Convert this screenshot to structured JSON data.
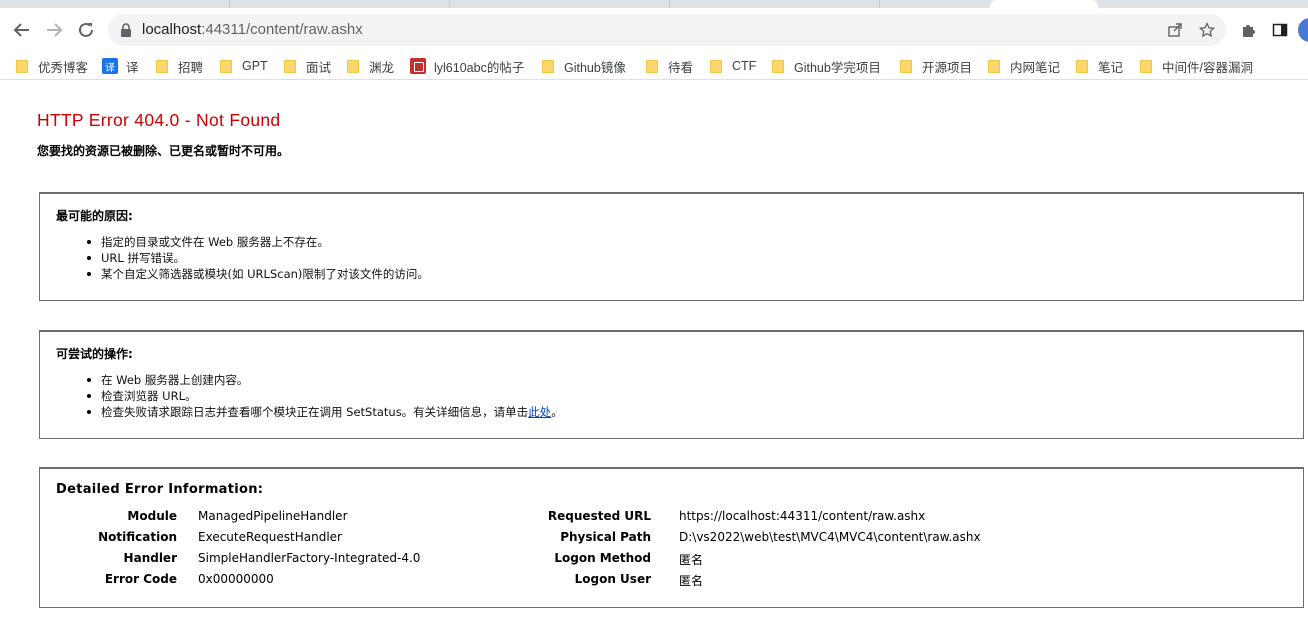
{
  "browser": {
    "url_host": "localhost",
    "url_path": ":44311/content/raw.ashx"
  },
  "bookmarks": [
    {
      "label": "优秀博客",
      "icon": "folder-icon"
    },
    {
      "label": "译",
      "icon": "translate-icon"
    },
    {
      "label": "招聘",
      "icon": "folder-icon"
    },
    {
      "label": "GPT",
      "icon": "folder-icon"
    },
    {
      "label": "面试",
      "icon": "folder-icon"
    },
    {
      "label": "渊龙",
      "icon": "folder-icon"
    },
    {
      "label": "lyl610abc的帖子",
      "icon": "site-favicon-icon"
    },
    {
      "label": "Github镜像",
      "icon": "folder-icon"
    },
    {
      "label": "待看",
      "icon": "folder-icon"
    },
    {
      "label": "CTF",
      "icon": "folder-icon"
    },
    {
      "label": "Github学完项目",
      "icon": "folder-icon"
    },
    {
      "label": "开源项目",
      "icon": "folder-icon"
    },
    {
      "label": "内网笔记",
      "icon": "folder-icon"
    },
    {
      "label": "笔记",
      "icon": "folder-icon"
    },
    {
      "label": "中间件/容器漏洞",
      "icon": "folder-icon"
    }
  ],
  "error": {
    "title": "HTTP Error 404.0 - Not Found",
    "subtitle": "您要找的资源已被删除、已更名或暂时不可用。",
    "causes_heading": "最可能的原因:",
    "causes": [
      "指定的目录或文件在 Web 服务器上不存在。",
      "URL 拼写错误。",
      "某个自定义筛选器或模块(如 URLScan)限制了对该文件的访问。"
    ],
    "actions_heading": "可尝试的操作:",
    "actions": [
      "在 Web 服务器上创建内容。",
      "检查浏览器 URL。"
    ],
    "action3_prefix": "检查失败请求跟踪日志并查看哪个模块正在调用 SetStatus。有关详细信息，请单击",
    "action3_link": "此处",
    "action3_suffix": "。",
    "detail_heading": "Detailed Error Information:",
    "details_left": [
      {
        "label": "Module",
        "value": "ManagedPipelineHandler"
      },
      {
        "label": "Notification",
        "value": "ExecuteRequestHandler"
      },
      {
        "label": "Handler",
        "value": "SimpleHandlerFactory-Integrated-4.0"
      },
      {
        "label": "Error Code",
        "value": "0x00000000"
      }
    ],
    "details_right": [
      {
        "label": "Requested URL",
        "value": "https://localhost:44311/content/raw.ashx"
      },
      {
        "label": "Physical Path",
        "value": "D:\\vs2022\\web\\test\\MVC4\\MVC4\\content\\raw.ashx"
      },
      {
        "label": "Logon Method",
        "value": "匿名"
      },
      {
        "label": "Logon User",
        "value": "匿名"
      }
    ]
  }
}
